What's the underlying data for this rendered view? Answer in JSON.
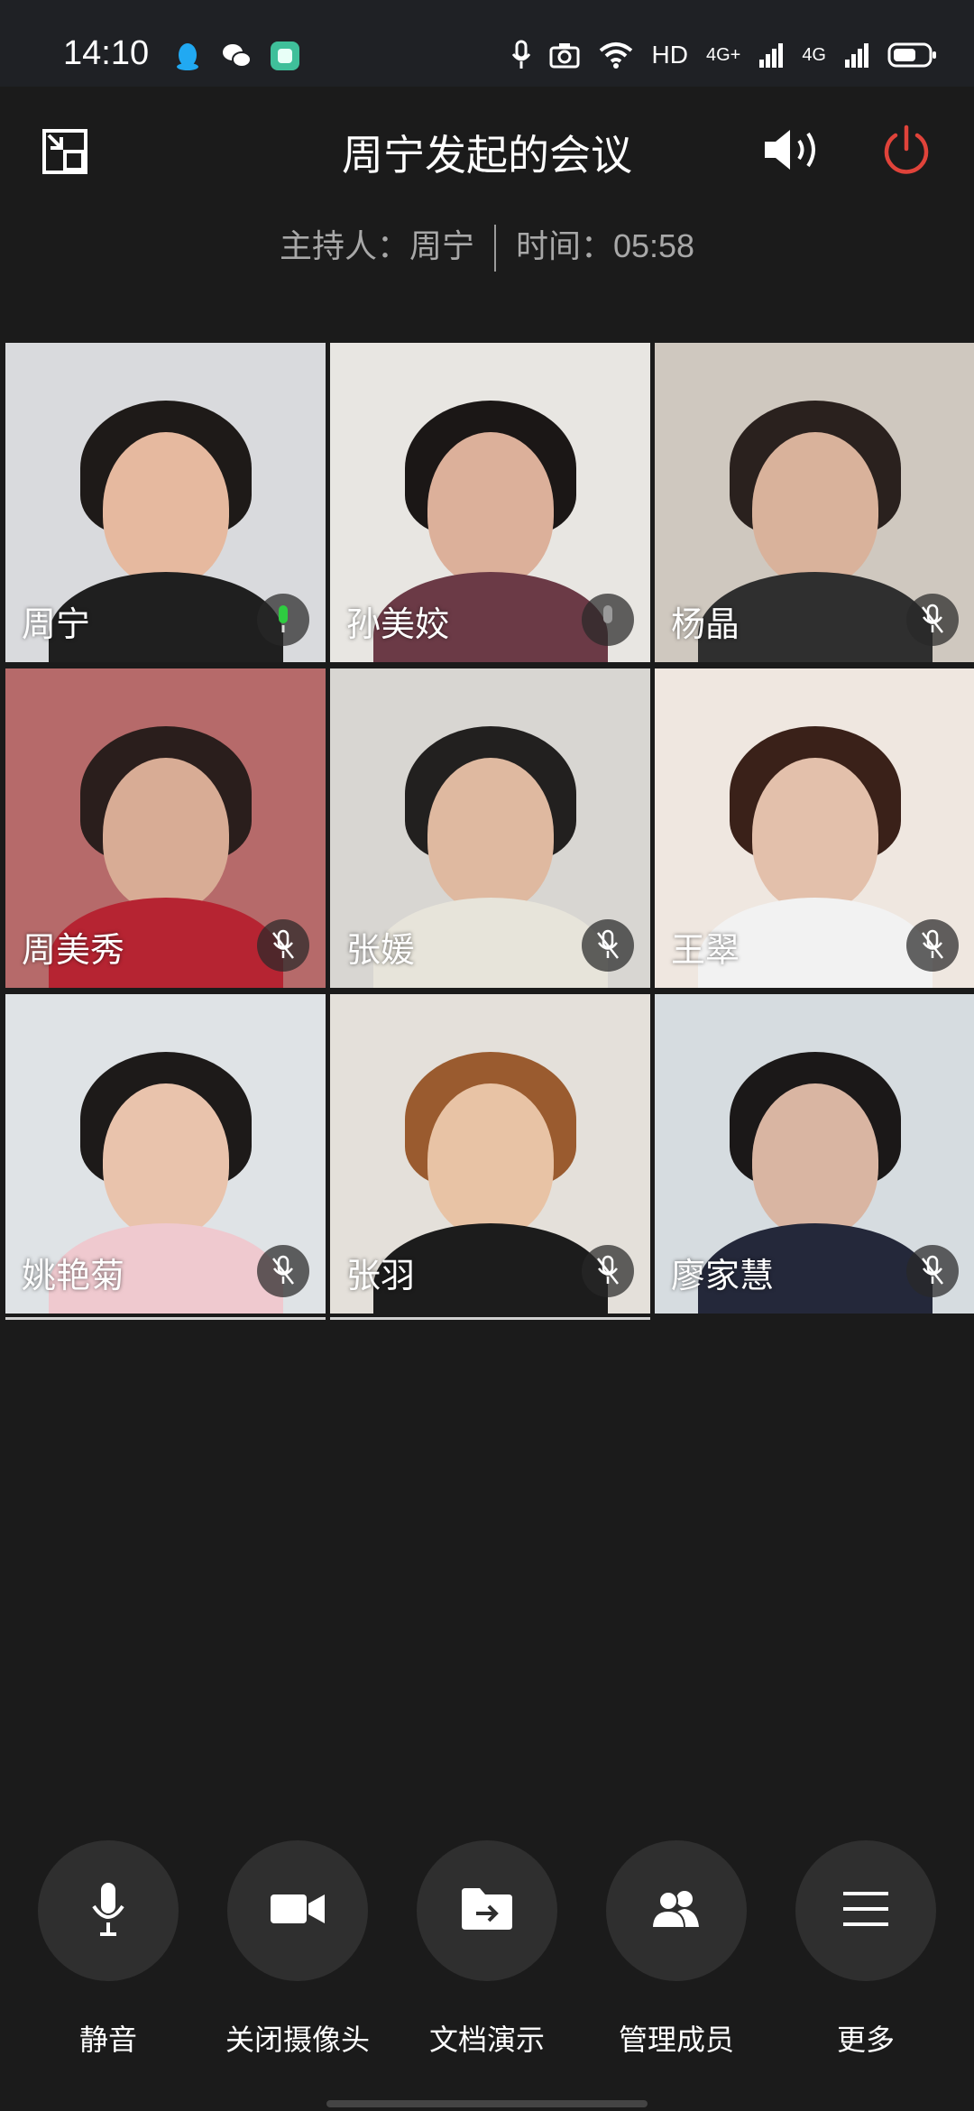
{
  "status_bar": {
    "time": "14:10",
    "left_icons": [
      "qq-icon",
      "wechat-icon",
      "app-icon"
    ],
    "right_icons": [
      "mic-icon",
      "camera-icon",
      "wifi-icon",
      "hd-icon",
      "signal-4g-icon",
      "signal-4g-icon",
      "battery-icon"
    ],
    "hd_label": "HD",
    "net1": "4G+",
    "net2": "4G"
  },
  "header": {
    "title": "周宁发起的会议",
    "host_label": "主持人：周宁",
    "time_label": "时间：05:58",
    "colors": {
      "power": "#e0433a"
    }
  },
  "participants": [
    {
      "name": "周宁",
      "mic_state": "active",
      "bg": "#d9dadd",
      "hair": "#1e1a18",
      "skin": "#e6b99f",
      "shirt": "#1f1f1f"
    },
    {
      "name": "孙美姣",
      "mic_state": "idle",
      "bg": "#e8e6e2",
      "hair": "#1b1716",
      "skin": "#dcb09a",
      "shirt": "#6b3a46"
    },
    {
      "name": "杨晶",
      "mic_state": "muted",
      "bg": "#cfc8bf",
      "hair": "#2a211e",
      "skin": "#d9b29b",
      "shirt": "#2f2f2f"
    },
    {
      "name": "周美秀",
      "mic_state": "muted",
      "bg": "#b66a6a",
      "hair": "#2a1e1c",
      "skin": "#d8ac95",
      "shirt": "#b62432"
    },
    {
      "name": "张媛",
      "mic_state": "muted",
      "bg": "#d8d6d2",
      "hair": "#22201f",
      "skin": "#dfb9a0",
      "shirt": "#e7e4da"
    },
    {
      "name": "王翠",
      "mic_state": "muted",
      "bg": "#efe7e0",
      "hair": "#3a2119",
      "skin": "#e3c0ab",
      "shirt": "#f2f2f2"
    },
    {
      "name": "姚艳菊",
      "mic_state": "muted",
      "bg": "#dfe3e6",
      "hair": "#1d1a19",
      "skin": "#e9c3ac",
      "shirt": "#efc9cf"
    },
    {
      "name": "张羽",
      "mic_state": "muted",
      "bg": "#e4e0da",
      "hair": "#9a5b2f",
      "skin": "#e8c3a5",
      "shirt": "#1c1c1c"
    },
    {
      "name": "廖家慧",
      "mic_state": "muted",
      "bg": "#d6dce0",
      "hair": "#1b1818",
      "skin": "#d9b5a2",
      "shirt": "#24283a"
    }
  ],
  "controls": [
    {
      "label": "静音",
      "icon": "microphone-icon"
    },
    {
      "label": "关闭摄像头",
      "icon": "video-camera-icon"
    },
    {
      "label": "文档演示",
      "icon": "share-folder-icon"
    },
    {
      "label": "管理成员",
      "icon": "members-icon"
    },
    {
      "label": "更多",
      "icon": "menu-icon"
    }
  ]
}
